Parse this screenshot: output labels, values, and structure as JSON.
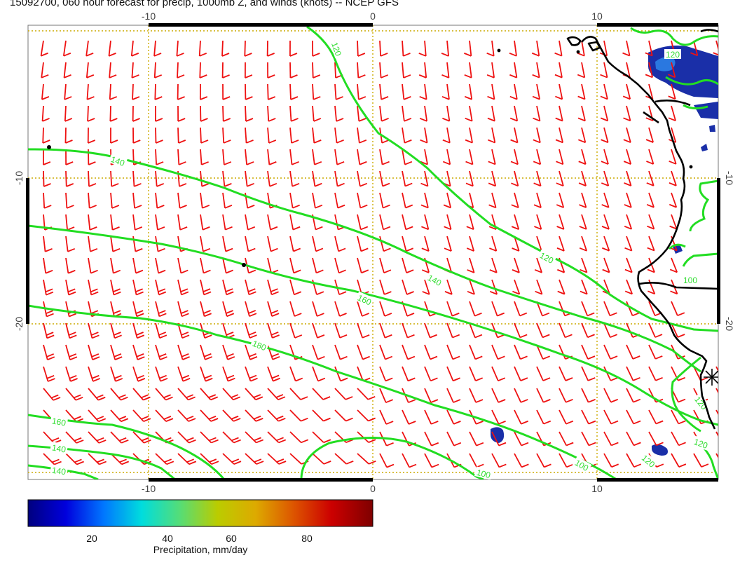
{
  "title": "15092700, 060 hour forecast for precip, 1000mb Z, and winds (knots) -- NCEP GFS",
  "axes": {
    "top_ticks": [
      "-10",
      "0",
      "10"
    ],
    "bottom_ticks": [
      "-10",
      "0",
      "10"
    ],
    "left_ticks": [
      "-10",
      "-20"
    ],
    "right_ticks": [
      "-10",
      "-20"
    ]
  },
  "colorbar": {
    "label": "Precipitation, mm/day",
    "ticks": [
      "20",
      "40",
      "60",
      "80"
    ],
    "colors": [
      "#00007f",
      "#0000dd",
      "#0077ff",
      "#00dddd",
      "#55dd77",
      "#bbcc00",
      "#ddaa00",
      "#dd5500",
      "#cc0000",
      "#7f0000"
    ]
  },
  "contours": {
    "color": "#22dd22",
    "labels": [
      "140",
      "120",
      "140",
      "160",
      "180",
      "160",
      "140",
      "140",
      "100",
      "100",
      "120",
      "120",
      "120",
      "100",
      "120",
      "120"
    ]
  },
  "colors": {
    "wind_barbs": "#ee1111",
    "grid": "#ccaa00",
    "coastline": "#000000",
    "precip_fill": "#1a2fa8"
  }
}
